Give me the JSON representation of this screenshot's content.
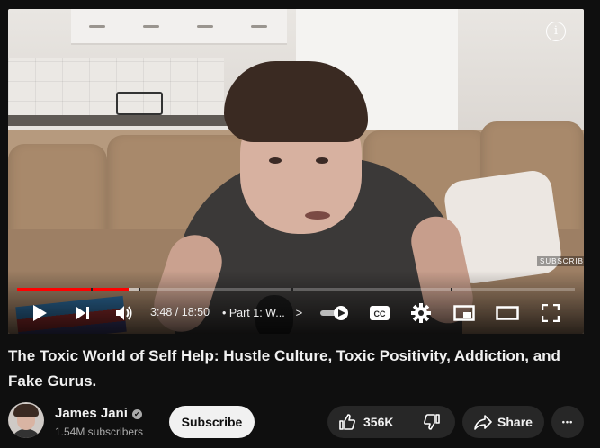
{
  "player": {
    "watermark": "SUBSCRIBE",
    "info_glyph": "i",
    "progress": {
      "played_fraction": 0.2,
      "loaded_fraction": 0.22
    },
    "time": "3:48 / 18:50",
    "chapter": "• Part 1: W...",
    "chapter_chevron": ">",
    "icons": [
      "play-icon",
      "next-icon",
      "volume-icon",
      "autoplay-toggle",
      "cc-icon",
      "settings-icon",
      "miniplayer-icon",
      "theater-icon",
      "fullscreen-icon"
    ]
  },
  "video": {
    "title": "The Toxic World of Self Help: Hustle Culture, Toxic Positivity, Addiction, and Fake Gurus."
  },
  "channel": {
    "name": "James Jani",
    "verified_glyph": "✔",
    "subscribers": "1.54M subscribers",
    "subscribe_label": "Subscribe"
  },
  "actions": {
    "like_count": "356K",
    "share_label": "Share",
    "more_glyph": "•••"
  },
  "colors": {
    "progress_played": "#ff0000",
    "page_bg": "#0f0f0f",
    "pill_bg": "#272727"
  }
}
